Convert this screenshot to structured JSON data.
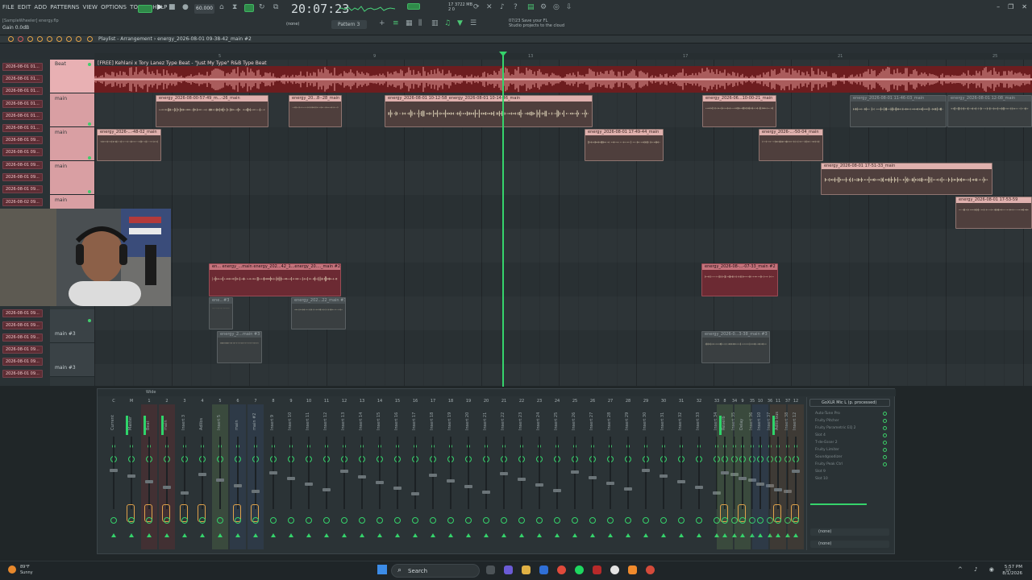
{
  "menu": {
    "items": [
      "FILE",
      "EDIT",
      "ADD",
      "PATTERNS",
      "VIEW",
      "OPTIONS",
      "TOOLS",
      "HELP"
    ],
    "project_file": "[SampleWheeler] energy.flp",
    "gain_label": "Gain  0.0dB"
  },
  "transport": {
    "tempo": "60.000",
    "clock": "20:07:23",
    "memory_line1": "17      3722 MB",
    "memory_line2": "2          0",
    "pattern": "Pattern 3",
    "none_label": "(none)"
  },
  "cloud_message": {
    "line1": "07/23  Save your FL",
    "line2": "Studio projects to the cloud"
  },
  "playlist": {
    "title": "Playlist - Arrangement › energy_2026-08-01 09-38-42_main #2",
    "ruler_ticks": [
      "5",
      "9",
      "13",
      "17",
      "21",
      "25",
      "29"
    ],
    "beat_track_title": "[FREE] Kehlani x Tory Lanez Type Beat - \"Just My Type\" R&B Type Beat",
    "track_headers": [
      {
        "name": "Beat",
        "style": "pink"
      },
      {
        "name": "main",
        "style": "pink2"
      },
      {
        "name": "main",
        "style": "pink2"
      },
      {
        "name": "main",
        "style": "pink2"
      },
      {
        "name": "main",
        "style": "pink2"
      },
      {
        "name": "main #3",
        "style": "grey"
      },
      {
        "name": "main #3",
        "style": "grey"
      }
    ],
    "picker_items": [
      "2026-08-01 01...",
      "2026-08-01 01...",
      "2026-08-01 01...",
      "2026-08-01 01...",
      "2026-08-01 01...",
      "2026-08-01 01...",
      "2026-08-01 09...",
      "2026-08-01 09...",
      "2026-08-01 09...",
      "2026-08-01 09...",
      "2026-08-01 09...",
      "2026-08-02 09..."
    ],
    "picker_items_lower": [
      "2026-08-01 09...",
      "2026-08-01 09...",
      "2026-08-01 09...",
      "2026-08-01 09...",
      "2026-08-01 09...",
      "2026-08-01 09...",
      "2026-08-01 09...",
      "2026-08-01 09..."
    ],
    "clips": [
      {
        "label": "energy_2026-08-00-57-49_m...-26_main",
        "style": "peach"
      },
      {
        "label": "energy_20...8--28_main",
        "style": "peach"
      },
      {
        "label": "energy_2026-08-01 10-12-58_energy_2026-08-01 10-14-46_main",
        "style": "peach"
      },
      {
        "label": "energy_2026-06...10-00-21_main",
        "style": "peach"
      },
      {
        "label": "energy_2026-08-01 11-46-03_main",
        "style": "dim"
      },
      {
        "label": "energy_2026-08-01 12-08_main",
        "style": "dim"
      },
      {
        "label": "energy_2026-...-48-02_main",
        "style": "peach"
      },
      {
        "label": "energy_2026-08-01 17-49-44_main",
        "style": "peach"
      },
      {
        "label": "energy_2026-...-50-04_main",
        "style": "peach"
      },
      {
        "label": "energy_2026-08-01 17-51-33_main",
        "style": "peach"
      },
      {
        "label": "energy_2026-08-01 17-53-59",
        "style": "peach"
      },
      {
        "label": "en... energy_...main energy_202...42_1...energy_20...._main #2",
        "style": "rose"
      },
      {
        "label": "energy_2026-08-...-07-33_main #2",
        "style": "rose"
      },
      {
        "label": "ene...#3",
        "style": "dim"
      },
      {
        "label": "energy_202...22_main #3",
        "style": "dim"
      },
      {
        "label": "energy_2...main #3",
        "style": "dim"
      },
      {
        "label": "energy_2026-0...3-38_main #3",
        "style": "dim"
      }
    ]
  },
  "mixer": {
    "title": "Mixer - Insert 8",
    "wide_label": "Wide",
    "channel_numbers": [
      "C",
      "M",
      "1",
      "2",
      "3",
      "4",
      "5",
      "6",
      "7",
      "8",
      "9",
      "10",
      "11",
      "12",
      "13",
      "14",
      "15",
      "16",
      "17",
      "18",
      "19",
      "20",
      "21",
      "22",
      "23",
      "24",
      "25",
      "26",
      "27",
      "28",
      "29",
      "30",
      "31",
      "32",
      "33",
      "34",
      "35",
      "36",
      "37",
      "8",
      "9",
      "10",
      "11",
      "12"
    ],
    "channel_names": [
      "Current",
      "Master",
      "Beat",
      "main",
      "Insert 3",
      "Adlibs",
      "Insert 5",
      "main",
      "main #2",
      "Insert 9",
      "Insert 10",
      "Insert 11",
      "Insert 12",
      "Insert 13",
      "Insert 14",
      "Insert 15",
      "Insert 16",
      "Insert 17",
      "Insert 18",
      "Insert 19",
      "Insert 20",
      "Insert 21",
      "Insert 22",
      "Insert 23",
      "Insert 24",
      "Insert 25",
      "Insert 26",
      "Insert 27",
      "Insert 28",
      "Insert 29",
      "Insert 30",
      "Insert 31",
      "Insert 32",
      "Insert 33",
      "Insert 34",
      "Insert 35",
      "Insert 36",
      "Insert 37",
      "Insert 38",
      "Reverb",
      "Delay",
      "Insert 10",
      "Adlib bus",
      "Insert 12"
    ],
    "insert_panel": {
      "title": "GoXLR Mic L (p. processed)",
      "slots": [
        "Auto-Tune Pro",
        "Fruity Pitcher",
        "Fruity Parametric EQ 2",
        "Slot 4",
        "T-de-Esser 2",
        "Fruity Limiter",
        "Soundgoodizer",
        "Fruity Peak Ctrl",
        "Slot 9",
        "Slot 10"
      ],
      "out_1": "(none)",
      "out_2": "(none)"
    }
  },
  "taskbar": {
    "weather_temp": "89°F",
    "weather_desc": "Sunny",
    "search_label": "Search",
    "time": "5:57 PM",
    "date": "8/1/2026"
  },
  "colors": {
    "accent_green": "#35d36b",
    "clip_peach": "#e0b1ae",
    "clip_rose": "#c4727b",
    "beat_track": "#6d1d1f"
  }
}
